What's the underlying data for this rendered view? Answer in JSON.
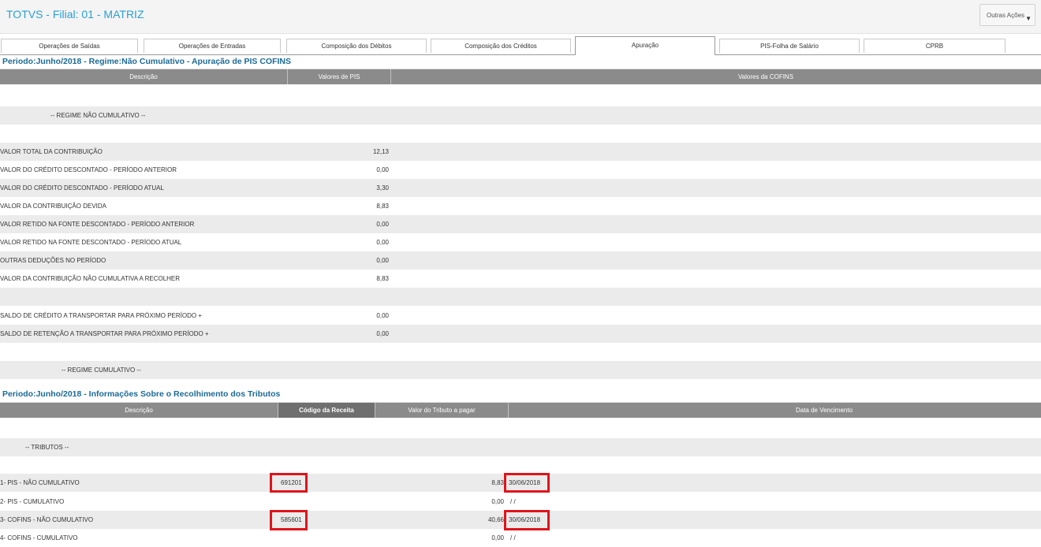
{
  "app": {
    "title": "TOTVS - Filial: 01 - MATRIZ",
    "actions_label": "Outras Ações",
    "actions_icon": "chevron-down-icon"
  },
  "tabs": [
    {
      "label": "Operações de Saídas"
    },
    {
      "label": "Operações de Entradas"
    },
    {
      "label": "Composição dos Débitos"
    },
    {
      "label": "Composição dos Créditos"
    },
    {
      "label": "Apuração",
      "active": true
    },
    {
      "label": "PIS-Folha de Salário"
    },
    {
      "label": "CPRB"
    }
  ],
  "apuracao": {
    "title": "Periodo:Junho/2018 - Regime:Não Cumulativo - Apuração de PIS COFINS",
    "columns": [
      "Descrição",
      "Valores de PIS",
      "Valores da COFINS"
    ],
    "regime_nao_cumulativo": "-- REGIME NÃO CUMULATIVO --",
    "rows": [
      {
        "desc": "VALOR TOTAL DA CONTRIBUIÇÃO",
        "pis": "12,13"
      },
      {
        "desc": "VALOR DO CRÉDITO DESCONTADO - PERÍODO ANTERIOR",
        "pis": "0,00"
      },
      {
        "desc": "VALOR DO CRÉDITO DESCONTADO - PERÍODO ATUAL",
        "pis": "3,30"
      },
      {
        "desc": "VALOR DA CONTRIBUIÇÃO DEVIDA",
        "pis": "8,83"
      },
      {
        "desc": "VALOR RETIDO NA FONTE DESCONTADO - PERÍODO ANTERIOR",
        "pis": "0,00"
      },
      {
        "desc": "VALOR RETIDO NA FONTE DESCONTADO - PERÍODO ATUAL",
        "pis": "0,00"
      },
      {
        "desc": "OUTRAS DEDUÇÕES NO PERÍODO",
        "pis": "0,00"
      },
      {
        "desc": "VALOR DA CONTRIBUIÇÃO NÃO CUMULATIVA A RECOLHER",
        "pis": "8,83"
      }
    ],
    "saldo_rows": [
      {
        "desc": "SALDO DE CRÉDITO A TRANSPORTAR PARA PRÓXIMO PERÍODO +",
        "pis": "0,00"
      },
      {
        "desc": "SALDO DE RETENÇÃO A TRANSPORTAR PARA PRÓXIMO PERÍODO +",
        "pis": "0,00"
      }
    ],
    "regime_cumulativo": "-- REGIME CUMULATIVO --"
  },
  "recolhimento": {
    "title": "Periodo:Junho/2018 - Informações Sobre o Recolhimento dos Tributos",
    "columns": [
      "Descrição",
      "Código da Receita",
      "Valor do Tributo a pagar",
      "Data de Vencimento"
    ],
    "tributos_label": "-- TRIBUTOS --",
    "rows": [
      {
        "desc": "1- PIS - NÃO CUMULATIVO",
        "codigo": "691201",
        "valor": "8,83",
        "vencimento": "30/06/2018"
      },
      {
        "desc": "2- PIS - CUMULATIVO",
        "codigo": "",
        "valor": "0,00",
        "vencimento": "/ /"
      },
      {
        "desc": "3- COFINS - NÃO CUMULATIVO",
        "codigo": "585601",
        "valor": "40,66",
        "vencimento": "30/06/2018"
      },
      {
        "desc": "4- COFINS - CUMULATIVO",
        "codigo": "",
        "valor": "0,00",
        "vencimento": "/ /"
      }
    ]
  },
  "colors": {
    "accent": "#2a9fd0",
    "section_title": "#1c6a95",
    "header_bg": "#8b8b8b",
    "highlight": "#e0141b"
  }
}
